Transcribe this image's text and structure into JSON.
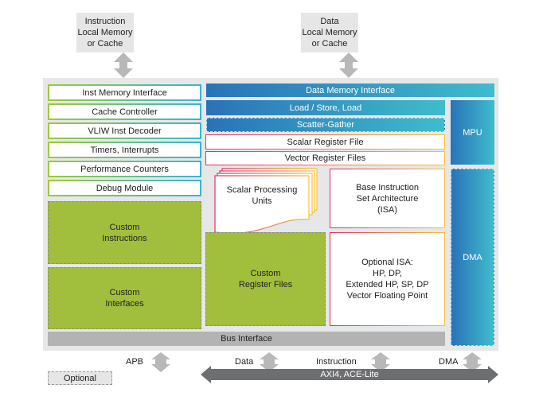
{
  "top_memories": {
    "instruction": "Instruction\nLocal Memory\nor Cache",
    "data": "Data\nLocal Memory\nor Cache"
  },
  "left_column": [
    "Inst Memory Interface",
    "Cache Controller",
    "VLIW Inst Decoder",
    "Timers, Interrupts",
    "Performance Counters",
    "Debug Module"
  ],
  "custom_instructions": "Custom\nInstructions",
  "custom_interfaces": "Custom\nInterfaces",
  "data_memory_interface": "Data Memory Interface",
  "load_store": "Load / Store,  Load",
  "scatter_gather": "Scatter-Gather",
  "scalar_register_file": "Scalar Register File",
  "vector_register_files": "Vector Register Files",
  "mpu": "MPU",
  "dma": "DMA",
  "scalar_processing_units": "Scalar Processing\nUnits",
  "base_isa": "Base Instruction\nSet Architecture\n(ISA)",
  "custom_register_files": "Custom\nRegister Files",
  "optional_isa": "Optional ISA:\nHP, DP,\nExtended HP, SP, DP\nVector Floating Point",
  "bus_interface": "Bus Interface",
  "bottom": {
    "apb": "APB",
    "data": "Data",
    "instruction": "Instruction",
    "dma": "DMA",
    "axi": "AXI4,  ACE-Lite"
  },
  "legend_optional": "Optional",
  "colors": {
    "panel": "#e6e7e8",
    "blue_start": "#2a72b8",
    "blue_end": "#3fbccc",
    "green": "#a1be3c",
    "bus": "#b3b3b3",
    "axi_arrow": "#6d6e70",
    "arrow": "#b8b8b8"
  }
}
